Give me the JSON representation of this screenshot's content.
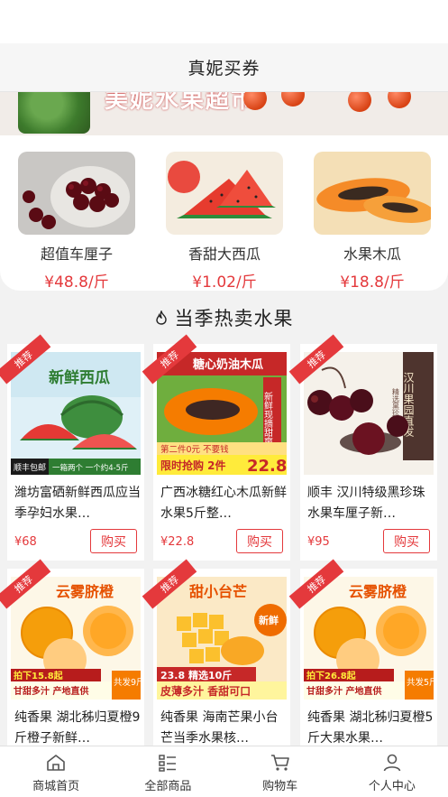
{
  "header": {
    "title": "真妮买券"
  },
  "banner": {
    "text": "美妮水果超市"
  },
  "recommend": [
    {
      "name": "超值车厘子",
      "price": "¥48.8/斤",
      "image": "cherries"
    },
    {
      "name": "香甜大西瓜",
      "price": "¥1.02/斤",
      "image": "watermelon"
    },
    {
      "name": "水果木瓜",
      "price": "¥18.8/斤",
      "image": "papaya"
    }
  ],
  "section": {
    "title": "当季热卖水果",
    "icon": "fire-icon"
  },
  "products": [
    {
      "badge": "推荐",
      "title": "潍坊富硒新鲜西瓜应当季孕妇水果…",
      "price": "¥68",
      "buy": "购买",
      "img_texts": {
        "headline": "新鲜西瓜",
        "corner": "顺丰包邮",
        "footer": "一箱两个 一个约4-5斤"
      }
    },
    {
      "badge": "推荐",
      "title": "广西冰糖红心木瓜新鲜水果5斤整…",
      "price": "¥22.8",
      "buy": "购买",
      "img_texts": {
        "headline": "糖心奶油木瓜",
        "side": "新鲜现摘甜爽多汁",
        "promo_top": "第二件0元 不要钱",
        "promo": "限时抢购 2件",
        "promo_price": "22.8"
      }
    },
    {
      "badge": "推荐",
      "title": "顺丰 汉川特级黑珍珠 水果车厘子新…",
      "price": "¥95",
      "buy": "购买",
      "img_texts": {
        "side": "汉川果园直发",
        "side_small": "精选黑珍珠"
      }
    },
    {
      "badge": "推荐",
      "title": "纯香果 湖北秭归夏橙9斤橙子新鲜…",
      "price": "",
      "buy": "",
      "img_texts": {
        "headline": "云雾脐橙",
        "price_line": "拍下15.8起",
        "footer": "甘甜多汁 产地直供",
        "right": "共发9斤"
      }
    },
    {
      "badge": "推荐",
      "title": "纯香果 海南芒果小台芒当季水果核…",
      "price": "",
      "buy": "",
      "img_texts": {
        "headline": "甜小台芒",
        "circle": "新鲜",
        "price_line": "23.8 精选10斤",
        "footer": "皮薄多汁 香甜可口"
      }
    },
    {
      "badge": "推荐",
      "title": "纯香果 湖北秭归夏橙5斤大果水果…",
      "price": "",
      "buy": "",
      "img_texts": {
        "headline": "云雾脐橙",
        "price_line": "拍下26.8起",
        "footer": "甘甜多汁 产地直供",
        "right": "共发5斤"
      }
    }
  ],
  "tabbar": [
    {
      "label": "商城首页",
      "icon": "home-icon"
    },
    {
      "label": "全部商品",
      "icon": "list-icon"
    },
    {
      "label": "购物车",
      "icon": "cart-icon"
    },
    {
      "label": "个人中心",
      "icon": "user-icon"
    }
  ],
  "colors": {
    "accent": "#e4393c",
    "background": "#f2f2f2"
  }
}
